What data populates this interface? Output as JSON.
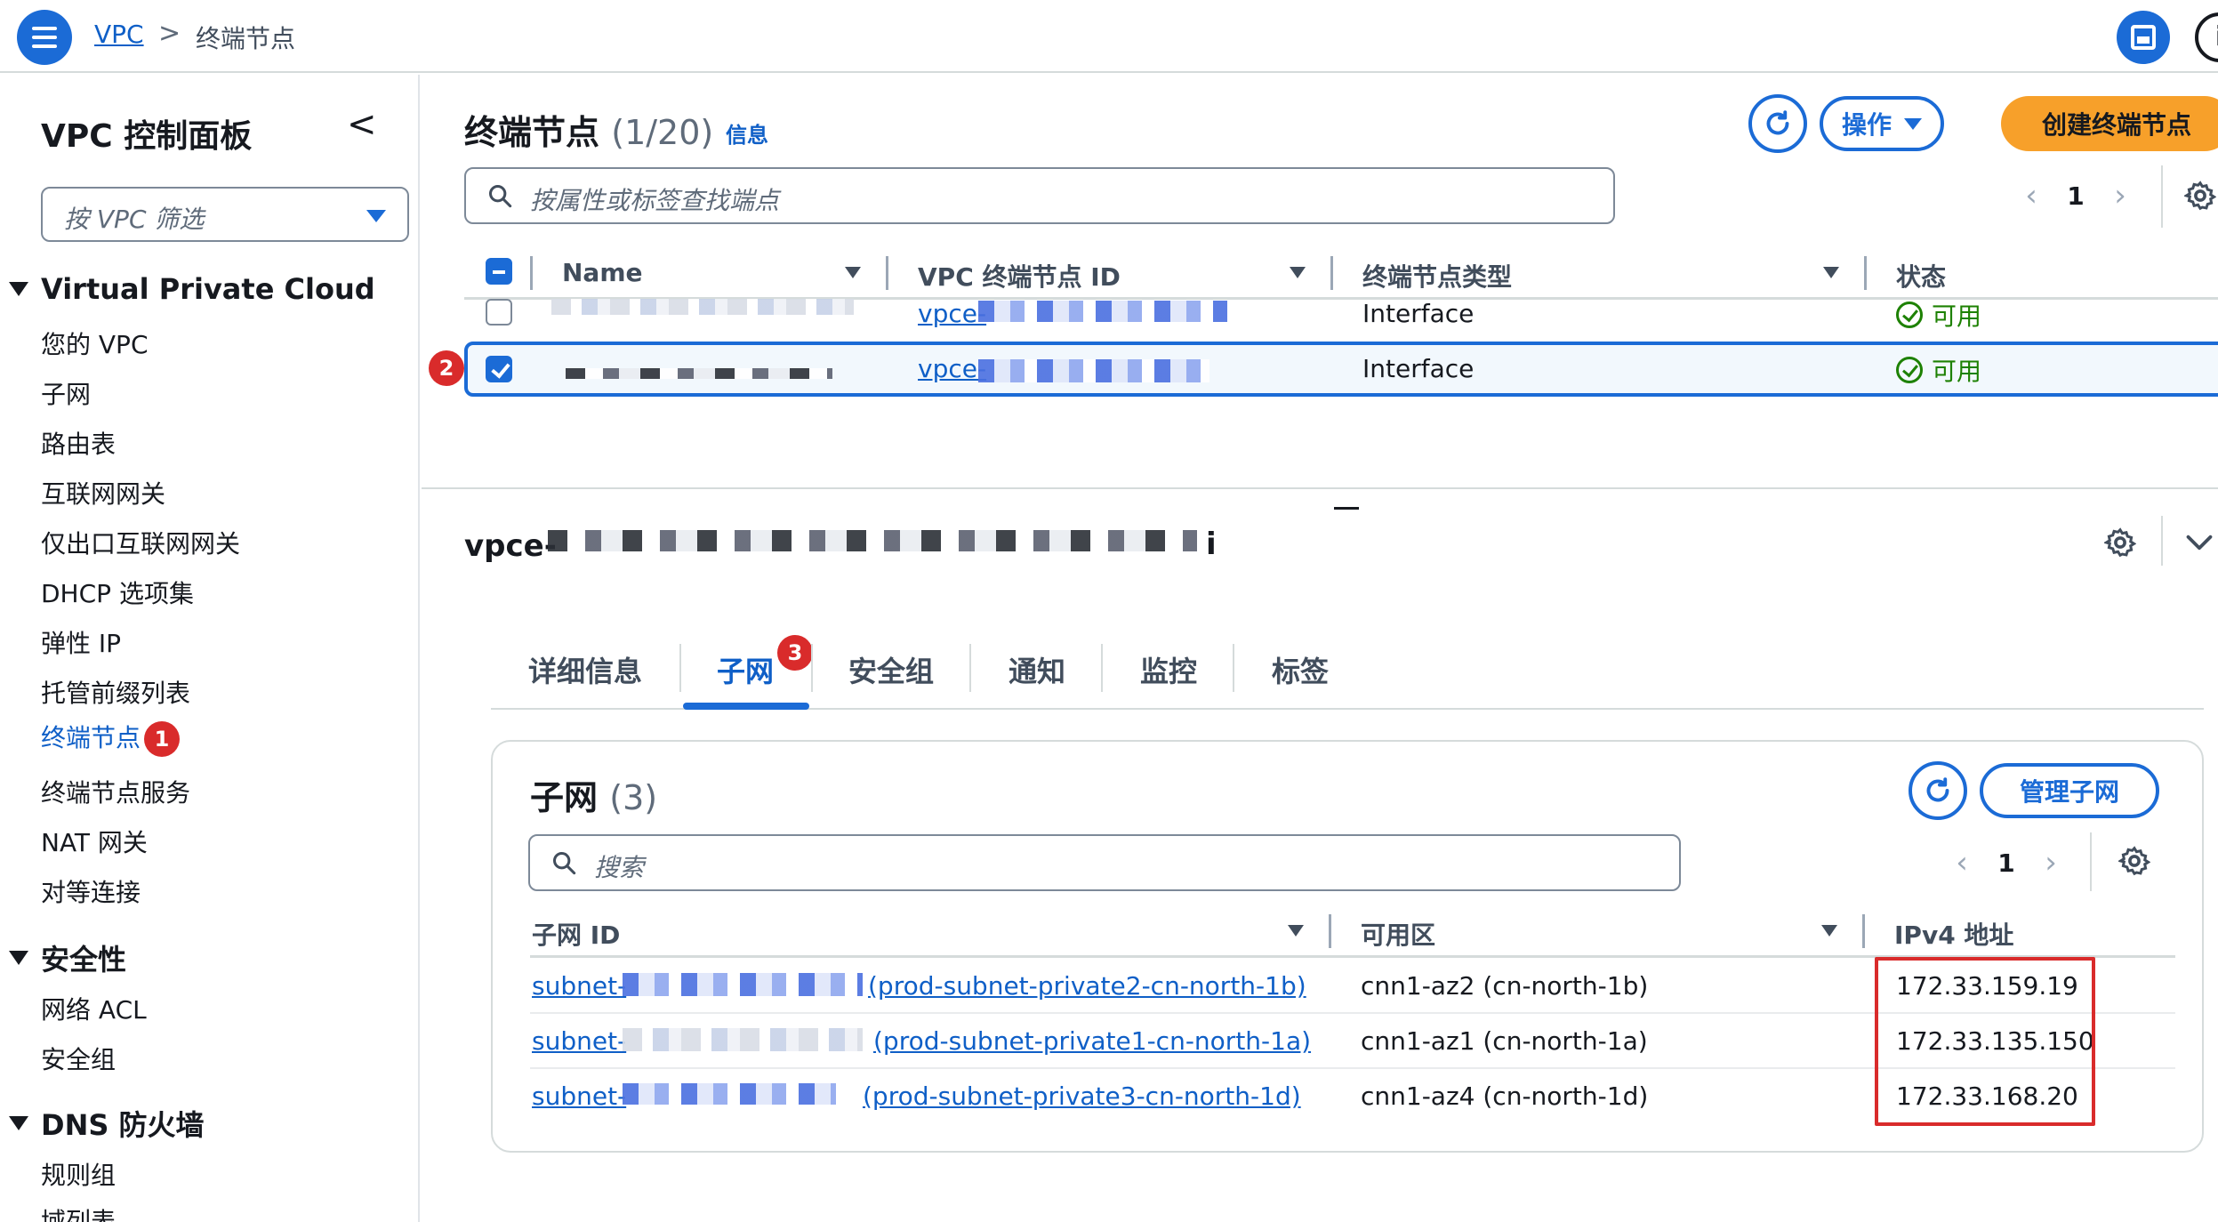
{
  "topbar": {
    "breadcrumb_root": "VPC",
    "breadcrumb_sep": ">",
    "breadcrumb_current": "终端节点"
  },
  "sidebar": {
    "title": "VPC 控制面板",
    "collapse_glyph": "<",
    "filter_placeholder": "按 VPC 筛选",
    "sections": {
      "vpc": {
        "heading": "Virtual Private Cloud",
        "items": [
          "您的 VPC",
          "子网",
          "路由表",
          "互联网网关",
          "仅出口互联网网关",
          "DHCP 选项集",
          "弹性 IP",
          "托管前缀列表",
          "终端节点",
          "终端节点服务",
          "NAT 网关",
          "对等连接"
        ],
        "active_badge": "1"
      },
      "security": {
        "heading": "安全性",
        "items": [
          "网络 ACL",
          "安全组"
        ]
      },
      "dns": {
        "heading": "DNS 防火墙",
        "items": [
          "规则组",
          "域列表"
        ]
      }
    }
  },
  "endpoints": {
    "title": "终端节点",
    "count": "(1/20)",
    "info_label": "信息",
    "actions_label": "操作",
    "create_label": "创建终端节点",
    "search_placeholder": "按属性或标签查找端点",
    "page": "1",
    "columns": [
      "Name",
      "VPC 终端节点 ID",
      "终端节点类型",
      "状态"
    ],
    "rows": [
      {
        "id_prefix": "vpce-",
        "type": "Interface",
        "status": "可用",
        "selected": false
      },
      {
        "id_prefix": "vpce-",
        "type": "Interface",
        "status": "可用",
        "selected": true,
        "badge": "2"
      }
    ]
  },
  "detail": {
    "title_prefix": "vpce-",
    "title_suffix": "i",
    "tabs": [
      "详细信息",
      "子网",
      "安全组",
      "通知",
      "监控",
      "标签"
    ],
    "active_tab_badge": "3"
  },
  "subnets": {
    "title": "子网",
    "count": "(3)",
    "manage_label": "管理子网",
    "search_placeholder": "搜索",
    "page": "1",
    "columns": [
      "子网 ID",
      "可用区",
      "IPv4 地址"
    ],
    "rows": [
      {
        "id_prefix": "subnet-",
        "name": "(prod-subnet-private2-cn-north-1b)",
        "az": "cnn1-az2 (cn-north-1b)",
        "ipv4": "172.33.159.19"
      },
      {
        "id_prefix": "subnet-",
        "name": "(prod-subnet-private1-cn-north-1a)",
        "az": "cnn1-az1 (cn-north-1a)",
        "ipv4": "172.33.135.150"
      },
      {
        "id_prefix": "subnet-",
        "name": "(prod-subnet-private3-cn-north-1d)",
        "az": "cnn1-az4 (cn-north-1d)",
        "ipv4": "172.33.168.20"
      }
    ]
  },
  "colors": {
    "accent": "#1b6bd6",
    "link": "#0f5fc7",
    "primary_button": "#f7a02a",
    "status_ok": "#1d8102",
    "annotation_red": "#d92b2b"
  }
}
